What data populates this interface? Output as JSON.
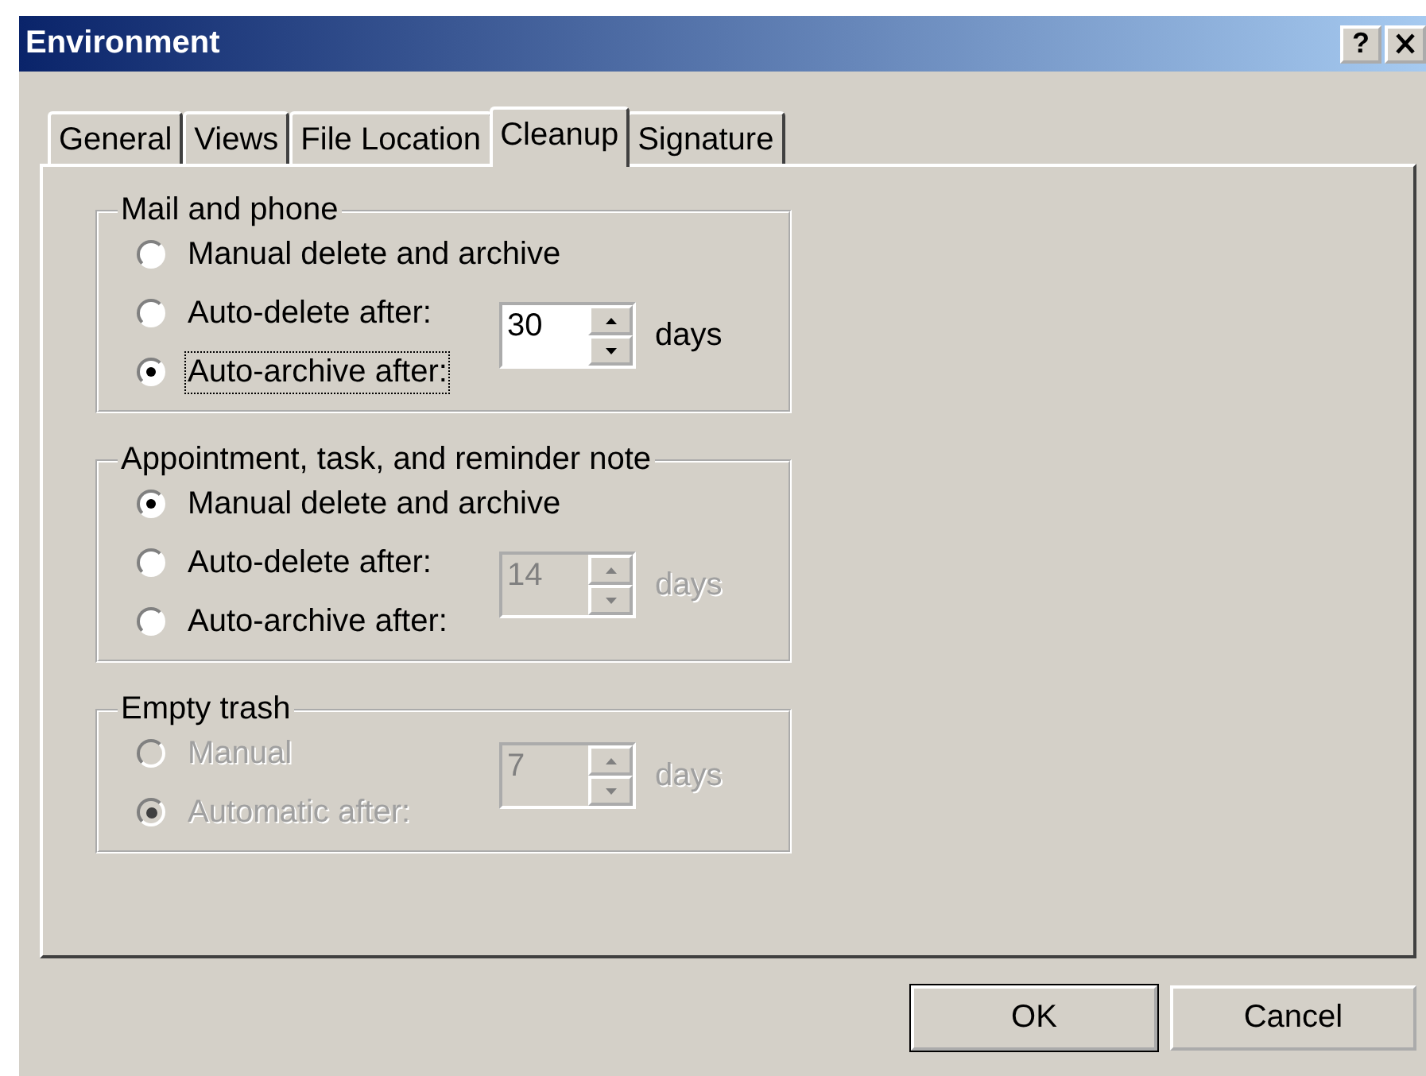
{
  "window": {
    "title": "Environment",
    "help_button": "?"
  },
  "tabs": [
    {
      "label": "General",
      "selected": false
    },
    {
      "label": "Views",
      "selected": false
    },
    {
      "label": "File Location",
      "selected": false
    },
    {
      "label": "Cleanup",
      "selected": true
    },
    {
      "label": "Signature",
      "selected": false
    }
  ],
  "groups": [
    {
      "title": "Mail and phone",
      "disabled": false,
      "options": [
        {
          "label": "Manual delete and archive",
          "selected": false,
          "focused": false
        },
        {
          "label": "Auto-delete after:",
          "selected": false,
          "focused": false
        },
        {
          "label": "Auto-archive after:",
          "selected": true,
          "focused": true
        }
      ],
      "spin": {
        "value": "30",
        "unit": "days",
        "disabled": false
      }
    },
    {
      "title": "Appointment, task, and reminder note",
      "disabled": false,
      "options": [
        {
          "label": "Manual delete and archive",
          "selected": true,
          "focused": false
        },
        {
          "label": "Auto-delete after:",
          "selected": false,
          "focused": false
        },
        {
          "label": "Auto-archive after:",
          "selected": false,
          "focused": false
        }
      ],
      "spin": {
        "value": "14",
        "unit": "days",
        "disabled": true
      }
    },
    {
      "title": "Empty trash",
      "disabled": true,
      "options": [
        {
          "label": "Manual",
          "selected": false,
          "focused": false
        },
        {
          "label": "Automatic after:",
          "selected": true,
          "focused": false
        }
      ],
      "spin": {
        "value": "7",
        "unit": "days",
        "disabled": true
      }
    }
  ],
  "buttons": [
    "OK",
    "Cancel"
  ]
}
